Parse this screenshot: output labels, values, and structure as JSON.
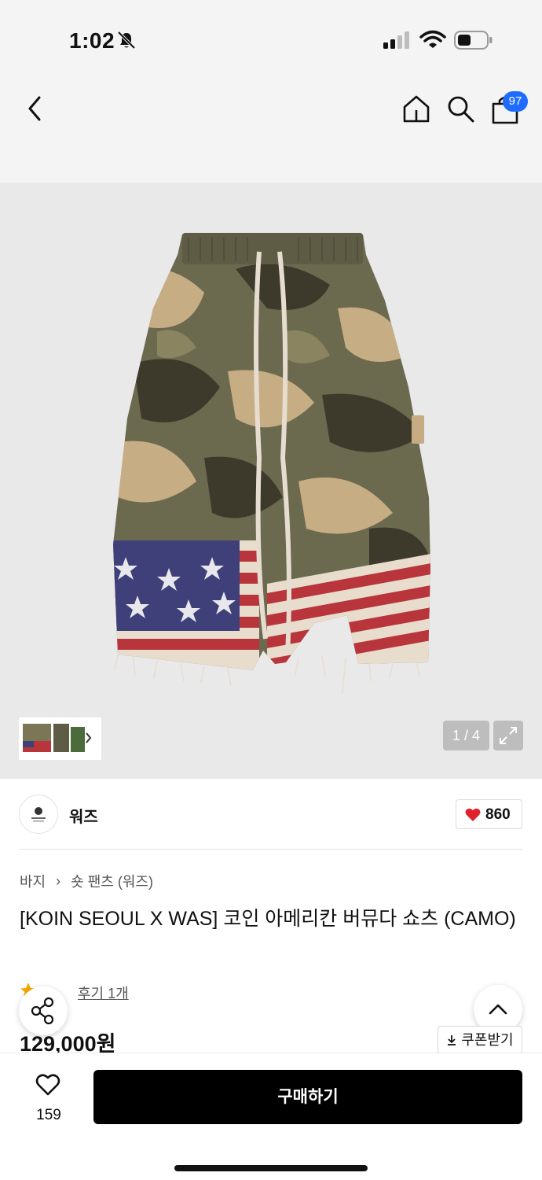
{
  "status_bar": {
    "time": "1:02"
  },
  "nav": {
    "cart_count": "97"
  },
  "gallery": {
    "counter": "1 / 4"
  },
  "brand": {
    "name": "워즈",
    "like_count": "860"
  },
  "breadcrumb": {
    "category": "바지",
    "separator": "›",
    "subcategory": "숏 팬츠 (워즈)"
  },
  "product": {
    "title": "[KOIN SEOUL X WAS] 코인 아메리칸 버뮤다 쇼츠 (CAMO)",
    "review_label": "후기 1개",
    "price": "129,000원"
  },
  "actions": {
    "coupon_label": "쿠폰받기",
    "wish_count": "159",
    "buy_label": "구매하기"
  },
  "colors": {
    "accent_badge": "#1e6bff",
    "heart": "#e0202b",
    "buy_button": "#000000"
  },
  "icons": [
    "bell-off-icon",
    "signal-icon",
    "wifi-icon",
    "battery-icon",
    "back-icon",
    "home-icon",
    "search-icon",
    "cart-icon",
    "expand-icon",
    "heart-icon",
    "star-icon",
    "share-icon",
    "chevron-up-icon",
    "download-icon"
  ]
}
